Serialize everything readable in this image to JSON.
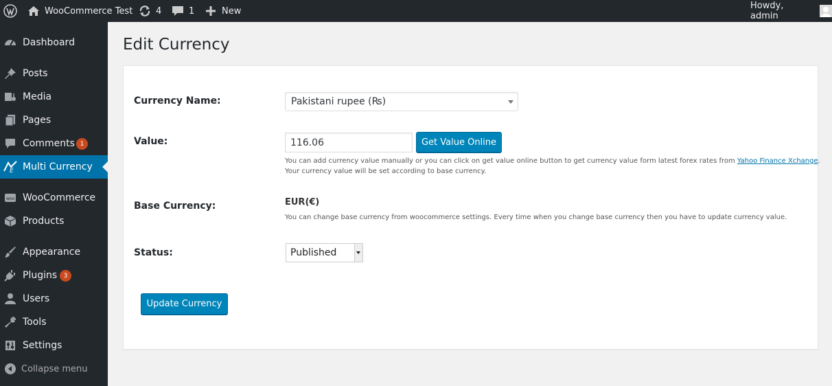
{
  "adminbar": {
    "site_name": "WooCommerce Test",
    "updates_count": "4",
    "comments_count": "1",
    "new_label": "New",
    "greeting": "Howdy, admin"
  },
  "sidebar": {
    "items": [
      {
        "label": "Dashboard",
        "icon": "dashboard-icon"
      },
      {
        "label": "Posts",
        "icon": "pin-icon"
      },
      {
        "label": "Media",
        "icon": "media-icon"
      },
      {
        "label": "Pages",
        "icon": "pages-icon"
      },
      {
        "label": "Comments",
        "icon": "comment-icon",
        "badge": "1"
      },
      {
        "label": "Multi Currency",
        "icon": "multi-currency-icon",
        "active": true
      },
      {
        "label": "WooCommerce",
        "icon": "woo-icon"
      },
      {
        "label": "Products",
        "icon": "box-icon"
      },
      {
        "label": "Appearance",
        "icon": "brush-icon"
      },
      {
        "label": "Plugins",
        "icon": "plugin-icon",
        "badge": "3"
      },
      {
        "label": "Users",
        "icon": "user-icon"
      },
      {
        "label": "Tools",
        "icon": "wrench-icon"
      },
      {
        "label": "Settings",
        "icon": "settings-icon"
      }
    ],
    "collapse_label": "Collapse menu"
  },
  "page": {
    "title": "Edit Currency"
  },
  "form": {
    "currency_name_label": "Currency Name:",
    "currency_name_value": "Pakistani rupee (₨)",
    "value_label": "Value:",
    "value_input": "116.06",
    "get_value_button": "Get Value Online",
    "value_desc_1": "You can add currency value manually or you can click on get value online button to get currency value form latest forex rates from ",
    "value_desc_link": "Yahoo Finance Xchange",
    "value_desc_1_end": ".",
    "value_desc_2": "Your currency value will be set according to base currency.",
    "base_currency_label": "Base Currency:",
    "base_currency_value": "EUR(€)",
    "base_currency_desc": "You can change base currency from woocommerce settings. Every time when you change base currency then you have to update currency value.",
    "status_label": "Status:",
    "status_value": "Published",
    "update_button": "Update Currency"
  },
  "colors": {
    "admin_dark": "#23282d",
    "accent": "#0073aa",
    "button": "#0085ba",
    "badge": "#ca4a1f",
    "background": "#f1f1f1"
  }
}
